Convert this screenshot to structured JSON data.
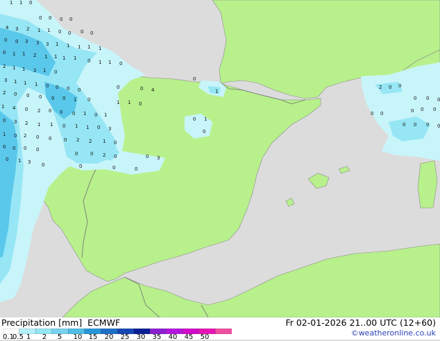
{
  "legend": {
    "title": "Precipitation [mm]",
    "model": "ECMWF",
    "valid_time": "Fr 02-01-2026 21..00 UTC (12+60)",
    "credit": "©weatheronline.co.uk",
    "ticks": [
      "0.1",
      "0.5",
      "1",
      "2",
      "5",
      "10",
      "15",
      "20",
      "25",
      "30",
      "35",
      "40",
      "45",
      "50"
    ],
    "colors": [
      "#ffffff",
      "#b4f0fa",
      "#96e6f5",
      "#78d2f0",
      "#50bee6",
      "#2896d7",
      "#1e6ec8",
      "#1446b4",
      "#0a1e96",
      "#8c1ed2",
      "#b414dc",
      "#d20ac8",
      "#e614b4",
      "#f050a0"
    ]
  },
  "map": {
    "sea_color": "#dcdcdc",
    "land_color": "#b8f08c",
    "border_color": "#6e6e6e",
    "precip_colors": {
      "light": "#c8f5fa",
      "moderate": "#96e6f5",
      "heavy": "#5ac8eb"
    },
    "labels": [
      "1",
      "1",
      "0",
      "0",
      "0",
      "0",
      "0",
      "0",
      "0",
      "4",
      "3",
      "2",
      "1",
      "1",
      "0",
      "0",
      "0",
      "0",
      "3",
      "3",
      "3",
      "1",
      "1",
      "1",
      "1",
      "1",
      "0",
      "1",
      "1",
      "2",
      "1",
      "1",
      "1",
      "1",
      "0",
      "1",
      "1",
      "0",
      "2",
      "1",
      "1",
      "2",
      "1",
      "0",
      "3",
      "1",
      "1",
      "1",
      "0",
      "0",
      "0",
      "0",
      "0",
      "0",
      "4",
      "2",
      "0",
      "0",
      "0",
      "0",
      "0",
      "1",
      "0",
      "1",
      "4",
      "0",
      "2",
      "0",
      "0",
      "0",
      "1",
      "0",
      "1",
      "1",
      "1",
      "0",
      "0",
      "3",
      "2",
      "1",
      "1",
      "0",
      "1",
      "1",
      "0",
      "3",
      "1",
      "0",
      "2",
      "0",
      "0",
      "0",
      "2",
      "2",
      "1",
      "0",
      "0",
      "0",
      "0",
      "0",
      "0",
      "0",
      "2",
      "0",
      "0",
      "3",
      "0",
      "1",
      "3",
      "0",
      "0",
      "0",
      "0",
      "0",
      "1",
      "0",
      "0",
      "1",
      "2",
      "0",
      "0",
      "0",
      "0",
      "0",
      "0",
      "0",
      "0",
      "0",
      "0",
      "0",
      "0",
      "0",
      "0",
      "0",
      "0"
    ]
  }
}
